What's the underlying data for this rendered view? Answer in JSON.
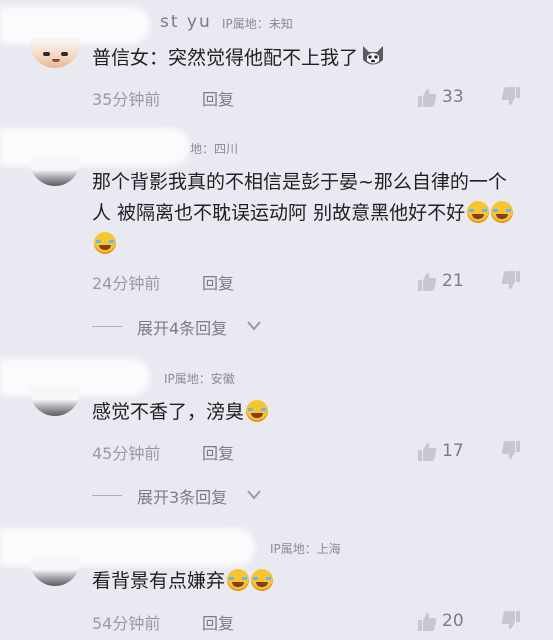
{
  "comments": [
    {
      "username": "st yu",
      "ip": "IP属地：未知",
      "text": "普信女：突然觉得他配不上我了",
      "emoji": "husky-emoji",
      "time": "35分钟前",
      "reply": "回复",
      "likes": "33"
    },
    {
      "username": "",
      "ip": "地：四川",
      "text": "那个背影我真的不相信是彭于晏~那么自律的一个人 被隔离也不耽误运动阿 别故意黑他好不好",
      "emoji": "crying-laugh-emoji",
      "time": "24分钟前",
      "reply": "回复",
      "likes": "21",
      "expand": "展开4条回复"
    },
    {
      "username": "",
      "ip": "IP属地：安徽",
      "text": "感觉不香了，滂臭",
      "emoji": "crying-laugh-emoji",
      "time": "45分钟前",
      "reply": "回复",
      "likes": "17",
      "expand": "展开3条回复"
    },
    {
      "username": "",
      "ip": "IP属地：上海",
      "text": "看背景有点嫌弃",
      "emoji": "crying-laugh-emoji",
      "time": "54分钟前",
      "reply": "回复",
      "likes": "20"
    }
  ],
  "colors": {
    "background": "#e9e9f1",
    "text": "#1f1f24",
    "meta": "#9a9aa3",
    "emoji": "#f8c532"
  }
}
